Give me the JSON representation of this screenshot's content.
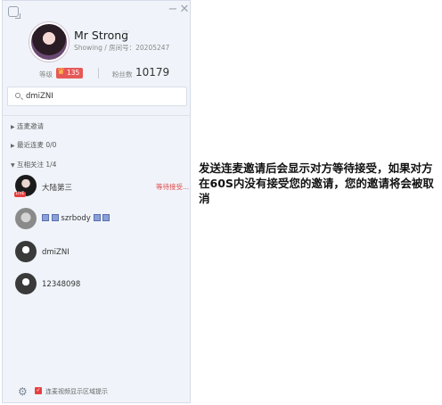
{
  "window": {
    "min_label": "−",
    "close_label": "✕"
  },
  "profile": {
    "name": "Mr Strong",
    "sub": "Showing / 房间号：20205247",
    "level_label": "等级",
    "level_value": "135",
    "fans_label": "粉丝数",
    "fans_count": "10179"
  },
  "search": {
    "value": "dmiZNI"
  },
  "sections": {
    "invite": "连麦邀请",
    "recent": "最近连麦 0/0",
    "mutual": "互相关注 1/4"
  },
  "friends": [
    {
      "name": "大陆第三",
      "status": "等待接受...",
      "live_tag": "LIVE"
    },
    {
      "name": "szrbody"
    },
    {
      "name": "dmiZNI"
    },
    {
      "name": "12348098"
    }
  ],
  "footer": {
    "gear_glyph": "⚙",
    "check_glyph": "✓",
    "checkbox_label": "连麦视频显示区域提示"
  },
  "note": "发送连麦邀请后会显示对方等待接受，如果对方在60S内没有接受您的邀请，您的邀请将会被取消"
}
